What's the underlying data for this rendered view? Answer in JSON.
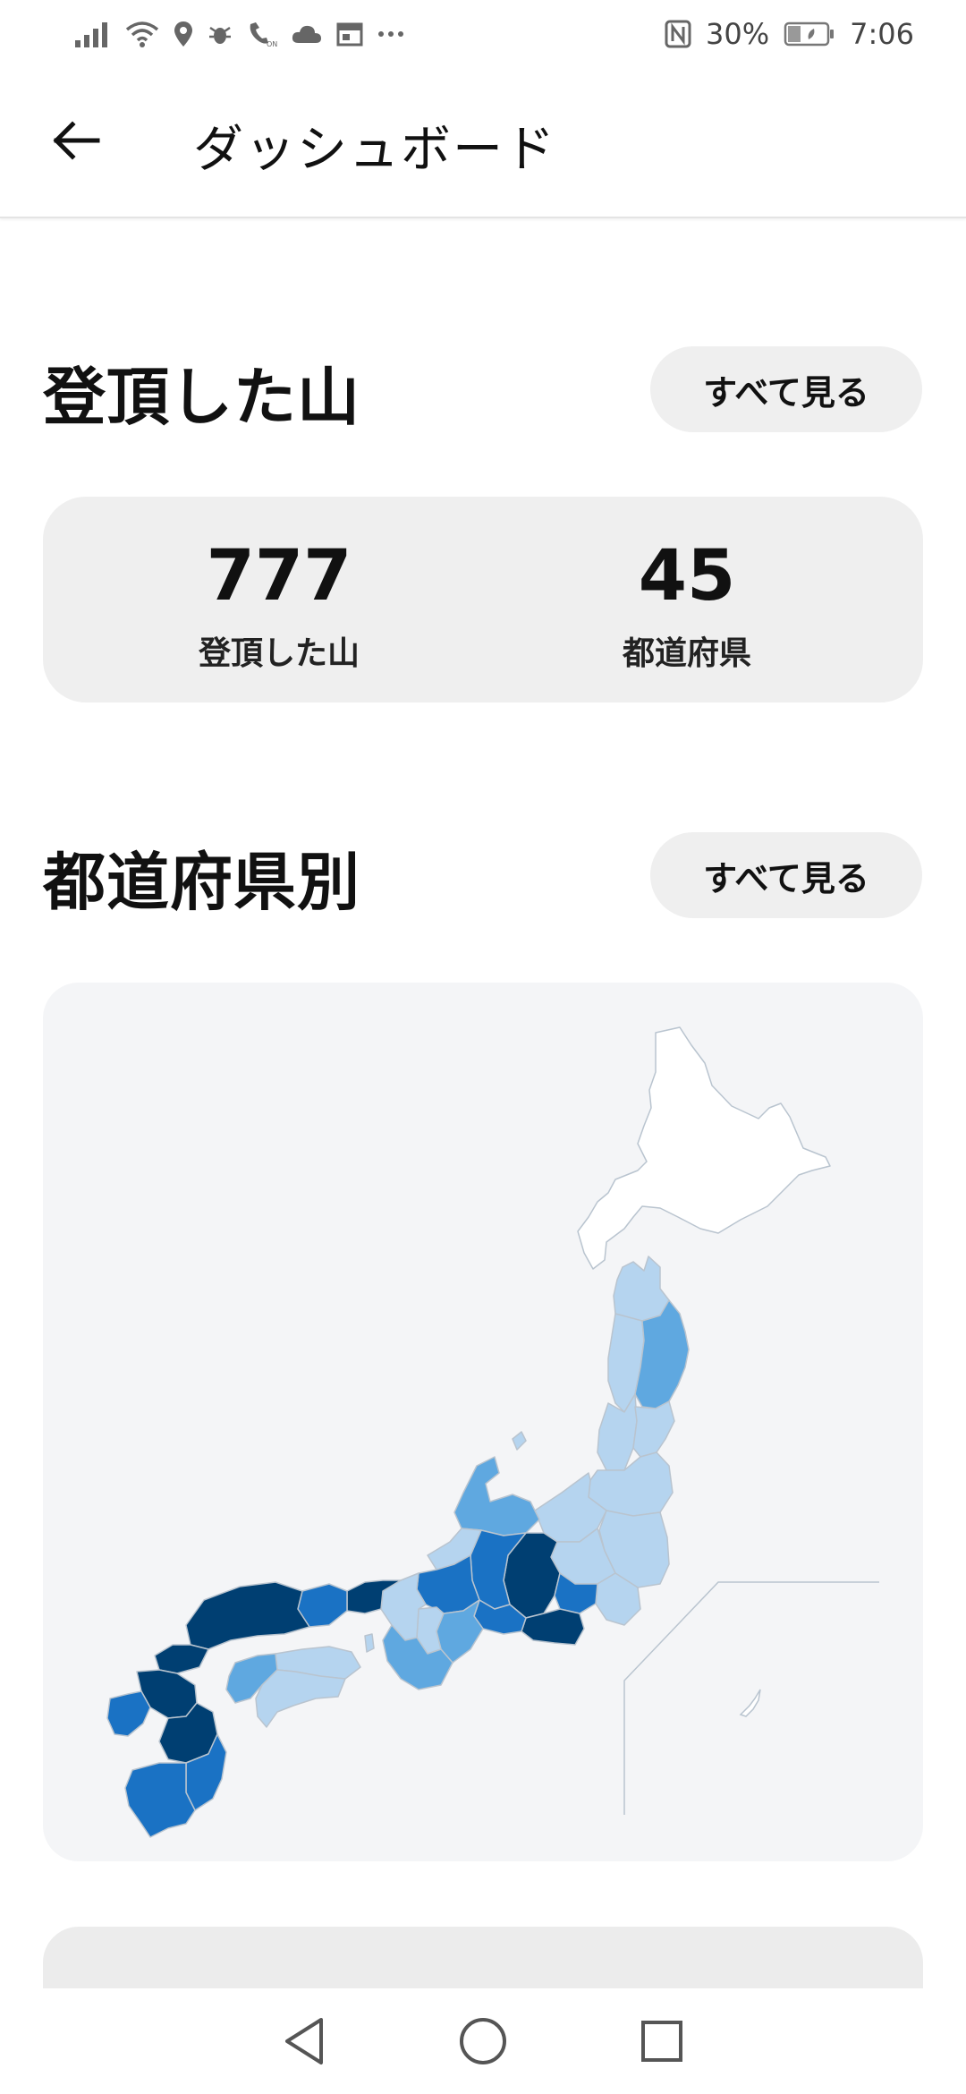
{
  "status_bar": {
    "battery": "30%",
    "time": "7:06"
  },
  "app_bar": {
    "title": "ダッシュボード"
  },
  "summit_section": {
    "title": "登頂した山",
    "see_all_label": "すべて見る",
    "stats": [
      {
        "value": "777",
        "label": "登頂した山"
      },
      {
        "value": "45",
        "label": "都道府県"
      }
    ]
  },
  "prefecture_section": {
    "title": "都道府県別",
    "see_all_label": "すべて見る"
  },
  "map": {
    "colors": {
      "none": "#ffffff",
      "low": "#b5d4ef",
      "mid": "#5fa8e0",
      "high": "#1a72c4",
      "max": "#003f72",
      "border": "#b9c4cf"
    }
  },
  "icons": {
    "back": "back-arrow-icon",
    "nav_back": "nav-back-triangle-icon",
    "nav_home": "nav-home-circle-icon",
    "nav_recents": "nav-recents-square-icon"
  }
}
